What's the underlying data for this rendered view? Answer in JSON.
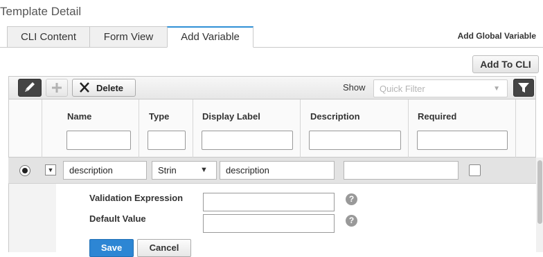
{
  "page": {
    "title": "Template Detail"
  },
  "tabs": [
    {
      "label": "CLI Content",
      "active": false
    },
    {
      "label": "Form View",
      "active": false
    },
    {
      "label": "Add Variable",
      "active": true
    }
  ],
  "links": {
    "add_global_variable": "Add Global Variable"
  },
  "buttons": {
    "add_to_cli": "Add To CLI"
  },
  "toolbar": {
    "delete_label": "Delete",
    "show_label": "Show",
    "quick_filter_placeholder": "Quick Filter",
    "icons": [
      "pencil-icon",
      "plus-icon",
      "close-icon",
      "chevron-down-icon",
      "filter-icon"
    ]
  },
  "columns": [
    "Name",
    "Type",
    "Display Label",
    "Description",
    "Required"
  ],
  "row": {
    "name": "description",
    "type": "Strin",
    "display_label": "description",
    "description": "",
    "required": false,
    "selected": true
  },
  "detail": {
    "validation_label": "Validation Expression",
    "default_label": "Default Value",
    "validation_value": "",
    "default_value": "",
    "help_icon_glyph": "?",
    "save_label": "Save",
    "cancel_label": "Cancel"
  },
  "colors": {
    "accent": "#2f8fd6",
    "save": "#2d86d4"
  }
}
